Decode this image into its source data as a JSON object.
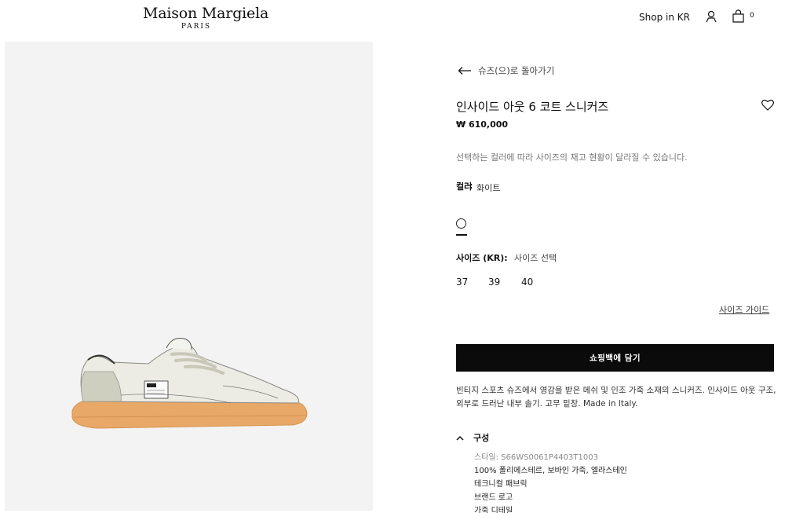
{
  "header": {
    "brand_name": "Maison Margiela",
    "brand_sub": "PARIS",
    "shop_in": "Shop in KR",
    "bag_count": "0",
    "icons": [
      "user-icon",
      "shopping-bag-icon"
    ]
  },
  "product": {
    "back_label": "슈즈(으)로 돌아가기",
    "name": "인사이드 아웃 6 코트 스니커즈",
    "price": "₩ 610,000",
    "notice": "선택하는 컬러에 따라 사이즈의 재고 현황이 달라질 수 있습니다.",
    "color_label": "컬러",
    "color_sep": ":",
    "color_value": "화이트",
    "selected_swatch_color": "#ffffff",
    "size_label": "사이즈 (KR):",
    "size_select": "사이즈 선택",
    "sizes": [
      "37",
      "39",
      "40"
    ],
    "size_guide": "사이즈 가이드",
    "add_to_bag": "쇼핑백에 담기",
    "description": "빈티지 스포츠 슈즈에서 영감을 받은 메쉬 및 인조 가죽 소재의 스니커즈. 인사이드 아웃 구조, 외부로 드러난 내부 솔기. 고무 밑창. Made in Italy.",
    "composition": {
      "title": "구성",
      "style": "스타일: S66WS0061P4403T1003",
      "items": [
        "100% 폴리에스테르, 보바인 가죽, 엘라스테인",
        "테크니컬 패브릭",
        "브랜드 로고",
        "가죽 디테일"
      ]
    }
  },
  "colors": {
    "button_bg": "#0b0b0b",
    "image_bg": "#f3f3f3",
    "sole": "#e8a868"
  }
}
